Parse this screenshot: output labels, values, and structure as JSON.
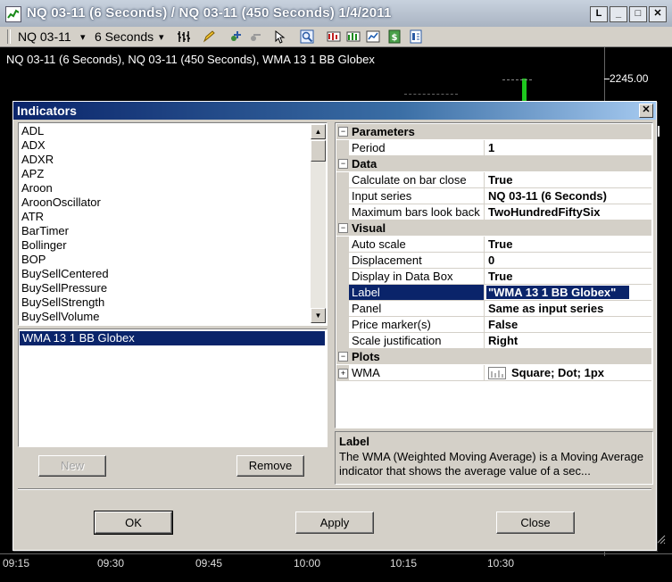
{
  "window": {
    "title": "NQ 03-11 (6 Seconds) / NQ 03-11 (450 Seconds)  1/4/2011",
    "buttons": {
      "l": "L",
      "minimize": "_",
      "maximize": "□",
      "close": "✕"
    }
  },
  "toolbar": {
    "instrument": "NQ 03-11",
    "interval": "6 Seconds",
    "dropdown_glyph": "▾"
  },
  "chart": {
    "header_label": "NQ 03-11 (6 Seconds), NQ 03-11 (450 Seconds), WMA 13 1 BB Globex",
    "price_label": "2245.00",
    "time_ticks": [
      "09:15",
      "09:30",
      "09:45",
      "10:00",
      "10:15",
      "10:30"
    ]
  },
  "dialog": {
    "title": "Indicators",
    "close": "✕",
    "indicator_list": [
      "ADL",
      "ADX",
      "ADXR",
      "APZ",
      "Aroon",
      "AroonOscillator",
      "ATR",
      "BarTimer",
      "Bollinger",
      "BOP",
      "BuySellCentered",
      "BuySellPressure",
      "BuySellStrength",
      "BuySellVolume"
    ],
    "applied": [
      "WMA 13 1 BB Globex"
    ],
    "new_button": "New",
    "remove_button": "Remove",
    "categories": {
      "parameters": "Parameters",
      "data": "Data",
      "visual": "Visual",
      "plots": "Plots"
    },
    "properties": {
      "period": {
        "name": "Period",
        "value": "1"
      },
      "calc_on_close": {
        "name": "Calculate on bar close",
        "value": "True"
      },
      "input_series": {
        "name": "Input series",
        "value": "NQ 03-11 (6 Seconds)"
      },
      "max_bars": {
        "name": "Maximum bars look back",
        "value": "TwoHundredFiftySix"
      },
      "auto_scale": {
        "name": "Auto scale",
        "value": "True"
      },
      "displacement": {
        "name": "Displacement",
        "value": "0"
      },
      "display_data_box": {
        "name": "Display in Data Box",
        "value": "True"
      },
      "label": {
        "name": "Label",
        "value": "\"WMA 13 1 BB Globex\""
      },
      "panel": {
        "name": "Panel",
        "value": "Same as input series"
      },
      "price_markers": {
        "name": "Price marker(s)",
        "value": "False"
      },
      "scale_justification": {
        "name": "Scale justification",
        "value": "Right"
      },
      "wma_plot": {
        "name": "WMA",
        "value": "Square; Dot; 1px"
      }
    },
    "description": {
      "title": "Label",
      "text": "The WMA (Weighted Moving Average) is a Moving Average indicator that shows the average value of a sec..."
    },
    "ok_button": "OK",
    "apply_button": "Apply",
    "close_button": "Close"
  }
}
